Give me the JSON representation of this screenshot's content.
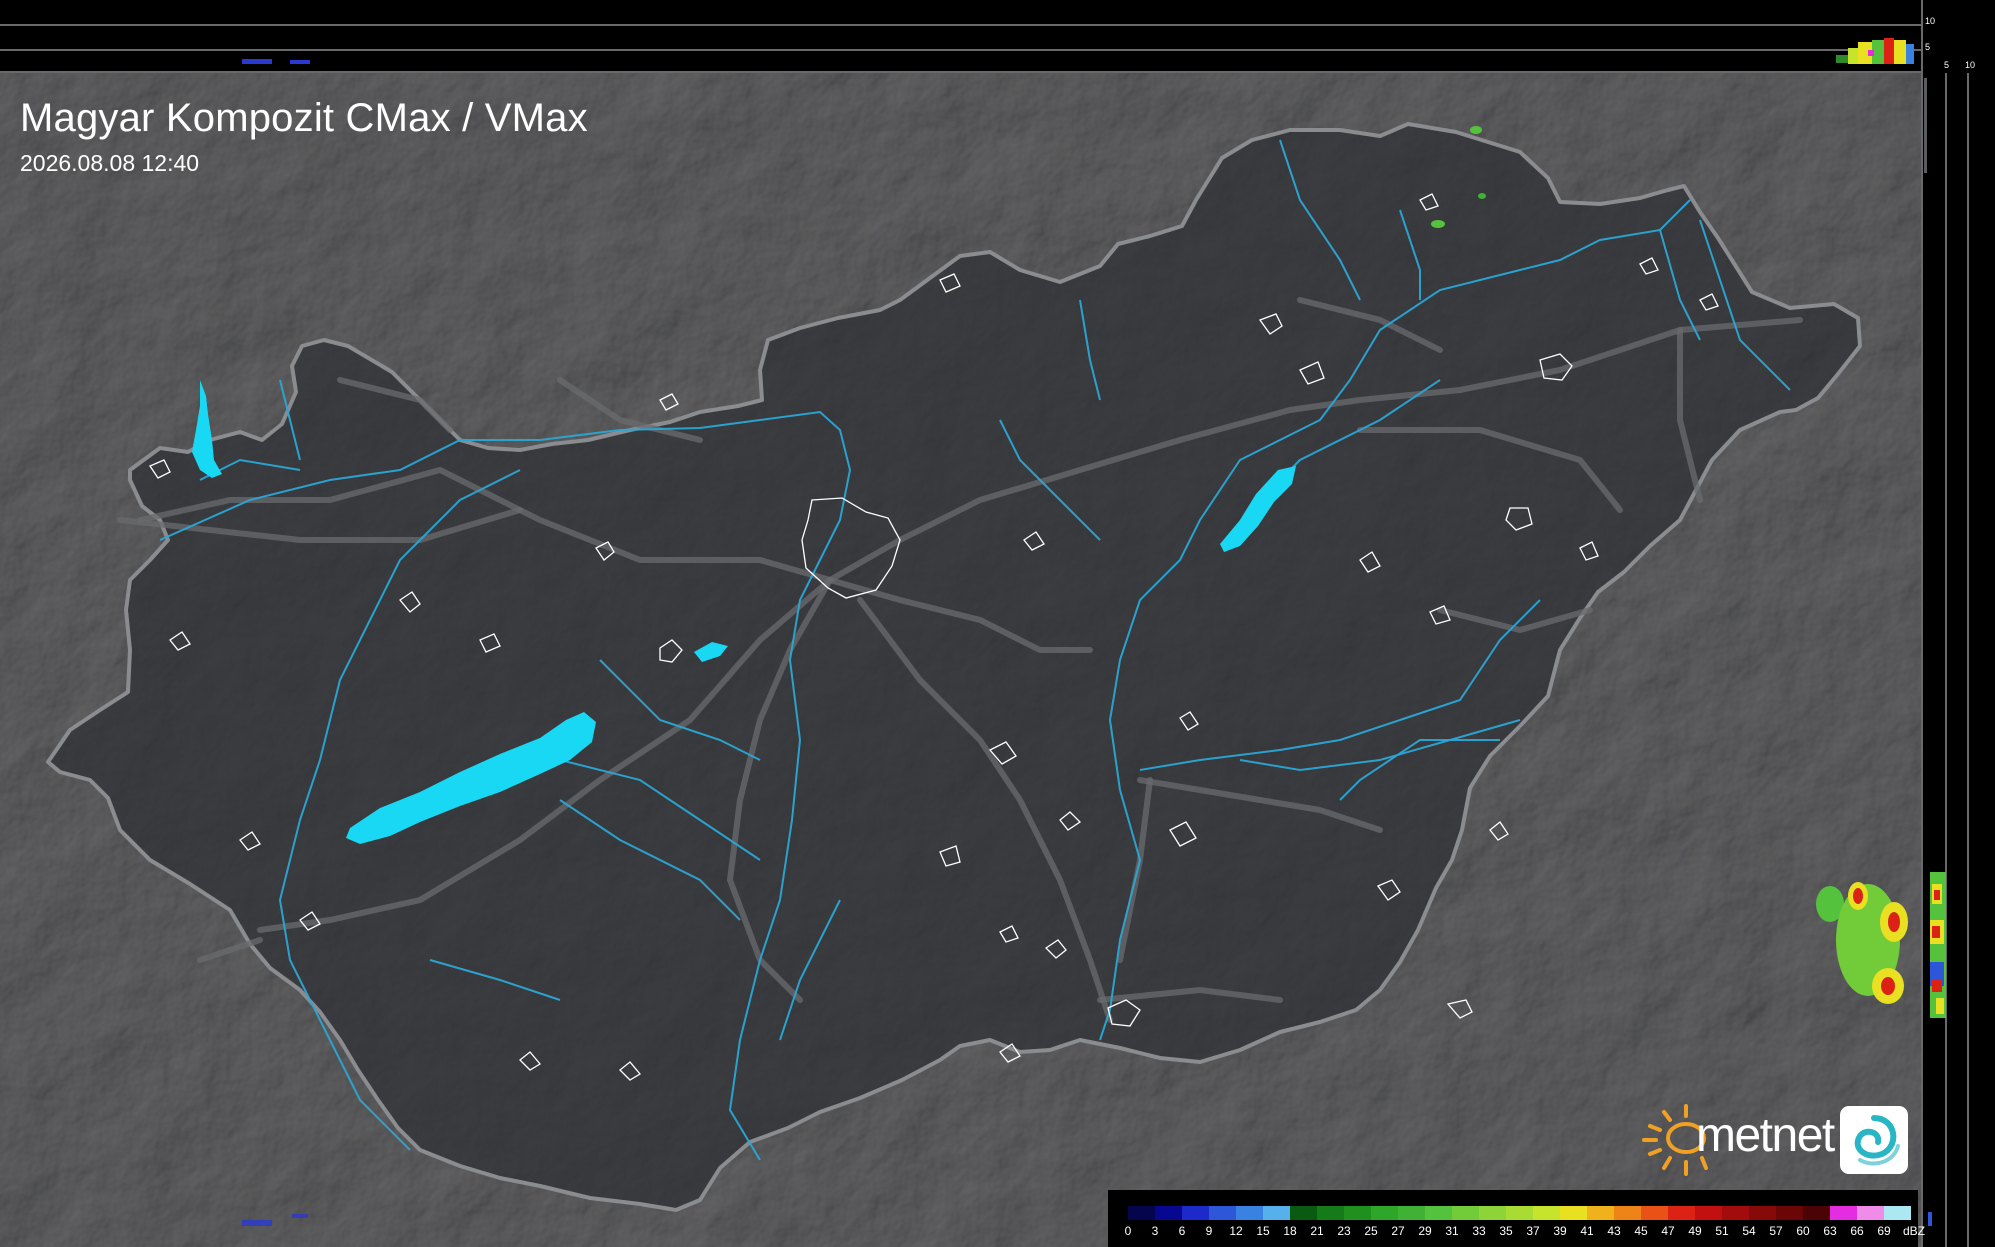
{
  "map": {
    "title": "Magyar Kompozit CMax / VMax",
    "timestamp": "2026.08.08 12:40",
    "country": "Hungary",
    "layers": [
      "terrain-hillshade",
      "country-border",
      "rivers",
      "lakes",
      "roads",
      "settlements",
      "radar-reflectivity"
    ],
    "colors": {
      "background": "#2a2b2d",
      "country_fill": "#3a3b3e",
      "border": "#8a8c90",
      "river": "#2aa7d6",
      "lake": "#19d8f4",
      "road": "#6a6b6e",
      "settlement_outline": "#ffffff"
    },
    "lakes": [
      "Balaton",
      "Velencei-to",
      "Ferto-to",
      "Tisza-to"
    ]
  },
  "profiles": {
    "top_axis": [
      "10",
      "5"
    ],
    "side_axis": [
      "5",
      "10"
    ]
  },
  "branding": {
    "logo_text": "metnet",
    "logo_icon": "sun-icon",
    "app_icon": "swirl-icon"
  },
  "legend": {
    "unit": "dBZ",
    "labels": [
      "0",
      "3",
      "6",
      "9",
      "12",
      "15",
      "18",
      "21",
      "23",
      "25",
      "27",
      "29",
      "31",
      "33",
      "35",
      "37",
      "39",
      "41",
      "43",
      "45",
      "47",
      "49",
      "51",
      "54",
      "57",
      "60",
      "63",
      "66",
      "69"
    ],
    "colors": [
      "#05054e",
      "#07078f",
      "#1c2ac9",
      "#2e56d9",
      "#3a82e2",
      "#55b0ec",
      "#0b5a12",
      "#157a18",
      "#1f8f1e",
      "#2ea62a",
      "#3fb236",
      "#55c23e",
      "#72cc3a",
      "#8ed438",
      "#a8dc33",
      "#c7e42c",
      "#e8e021",
      "#f0b21a",
      "#ee8418",
      "#e85216",
      "#dc2214",
      "#c21010",
      "#a30c0c",
      "#860a0a",
      "#6a0606",
      "#4c0303",
      "#e42ce0",
      "#f08ce8",
      "#ace8f2"
    ]
  }
}
